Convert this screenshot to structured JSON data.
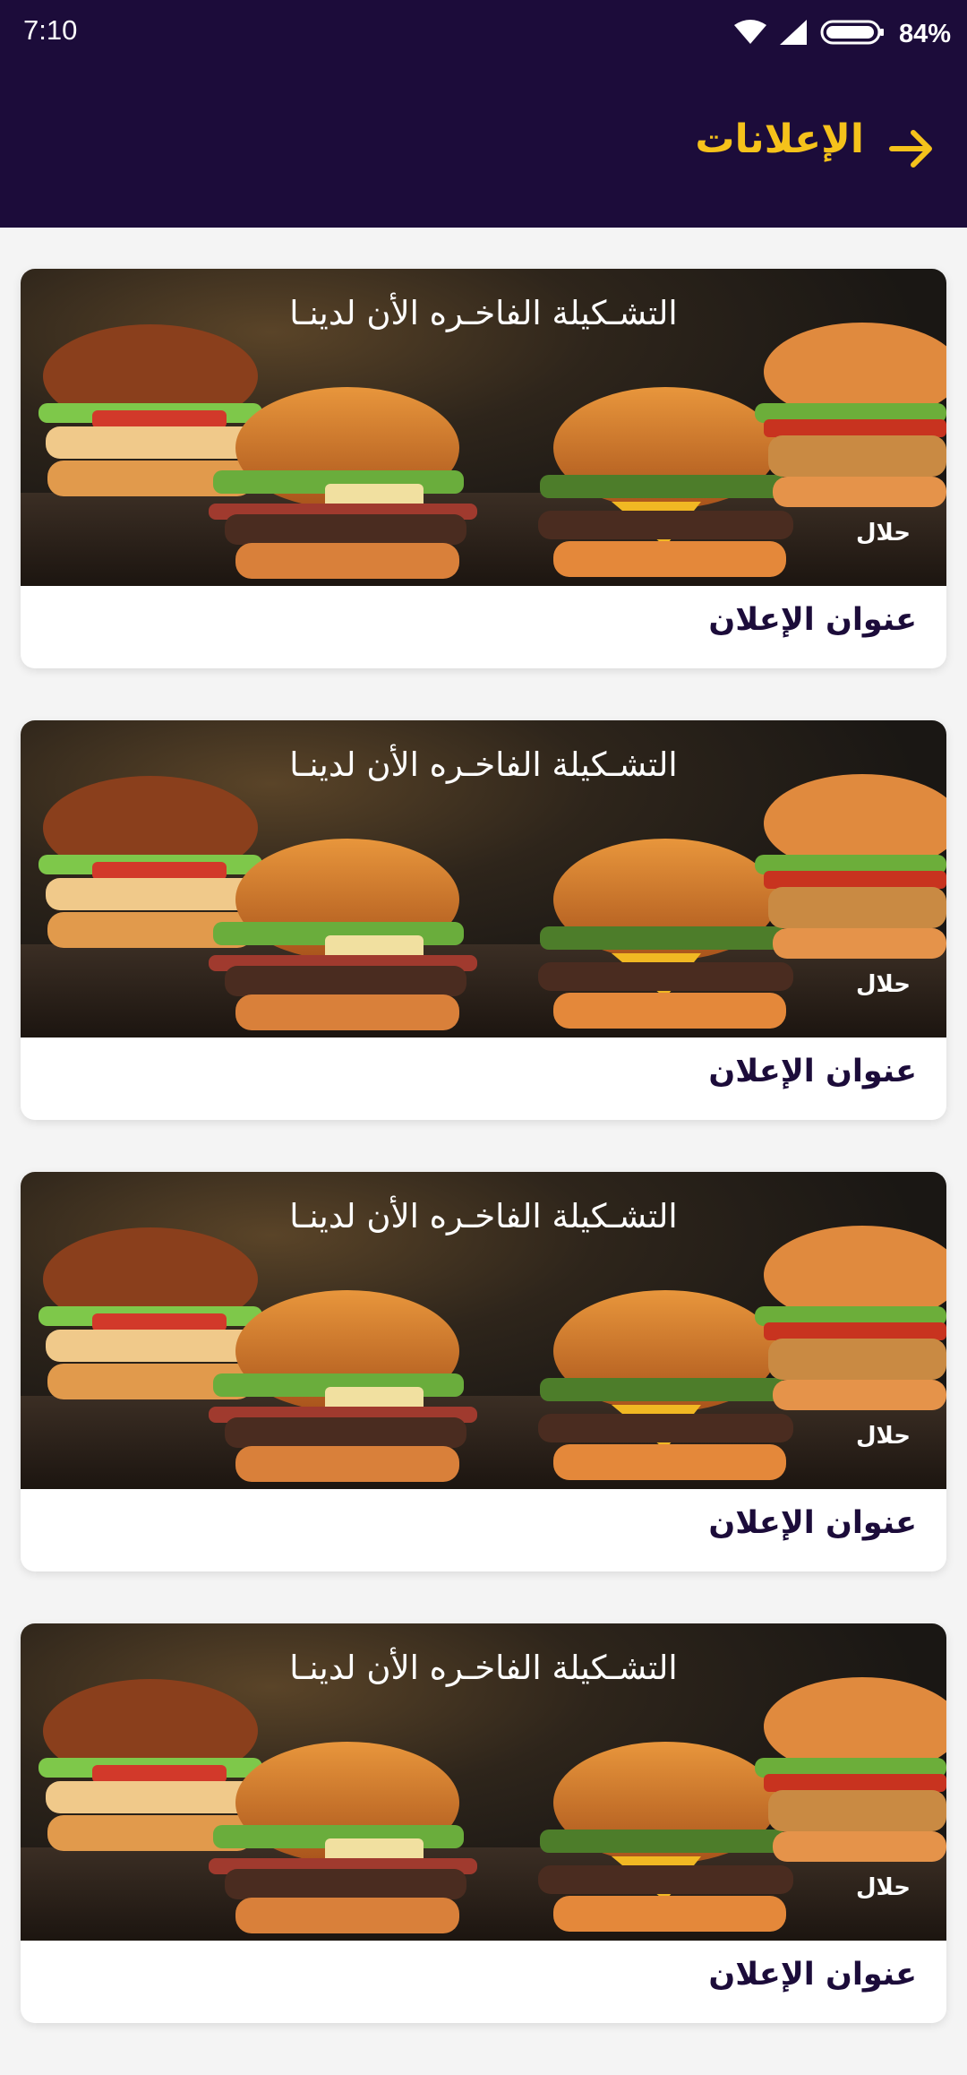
{
  "status_bar": {
    "time": "7:10",
    "battery_percent": "84%",
    "icons": [
      "wifi-icon",
      "signal-icon",
      "battery-icon"
    ]
  },
  "app_bar": {
    "title": "الإعلانات",
    "back_icon": "arrow-right-icon"
  },
  "colors": {
    "header_bg": "#1c0c3a",
    "accent": "#f5c21b",
    "title_text": "#1c0c3a"
  },
  "announcements": [
    {
      "headline": "التشـكيلة الفاخـره الأن لدينـا",
      "badge": "حلال",
      "title": "عنوان الإعلان"
    },
    {
      "headline": "التشـكيلة الفاخـره الأن لدينـا",
      "badge": "حلال",
      "title": "عنوان الإعلان"
    },
    {
      "headline": "التشـكيلة الفاخـره الأن لدينـا",
      "badge": "حلال",
      "title": "عنوان الإعلان"
    },
    {
      "headline": "التشـكيلة الفاخـره الأن لدينـا",
      "badge": "حلال",
      "title": "عنوان الإعلان"
    }
  ]
}
